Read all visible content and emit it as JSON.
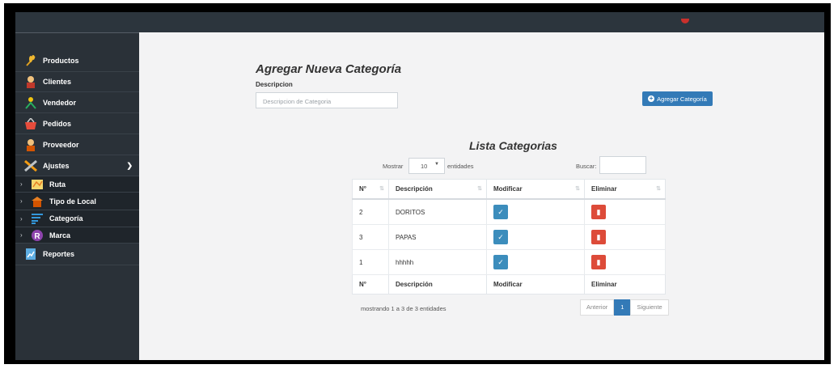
{
  "sidebar": {
    "items": [
      {
        "label": "Productos",
        "icon": "wheat-icon"
      },
      {
        "label": "Clientes",
        "icon": "person-icon"
      },
      {
        "label": "Vendedor",
        "icon": "seller-icon"
      },
      {
        "label": "Pedidos",
        "icon": "basket-icon"
      },
      {
        "label": "Proveedor",
        "icon": "supplier-icon"
      },
      {
        "label": "Ajustes",
        "icon": "tools-icon"
      }
    ],
    "subitems": [
      {
        "label": "Ruta",
        "icon": "map-icon"
      },
      {
        "label": "Tipo de Local",
        "icon": "store-icon"
      },
      {
        "label": "Categoría",
        "icon": "list-icon"
      },
      {
        "label": "Marca",
        "icon": "registered-icon"
      }
    ],
    "reportes": {
      "label": "Reportes",
      "icon": "report-icon"
    }
  },
  "form": {
    "title": "Agregar Nueva Categoría",
    "description_label": "Descripcion",
    "description_placeholder": "Descripcion de Categoria",
    "add_button": "Agregar Categoría"
  },
  "list": {
    "title": "Lista Categorias",
    "show_label": "Mostrar",
    "entries_value": "10",
    "entries_label": "entidades",
    "search_label": "Buscar:",
    "columns": [
      "N°",
      "Descripción",
      "Modificar",
      "Eliminar"
    ],
    "rows": [
      {
        "n": "2",
        "descripcion": "DORITOS"
      },
      {
        "n": "3",
        "descripcion": "PAPAS"
      },
      {
        "n": "1",
        "descripcion": "hhhhh"
      }
    ],
    "showing_text": "mostrando 1 a 3 de 3 entidades",
    "pagination": {
      "prev": "Anterior",
      "current": "1",
      "next": "Siguiente"
    }
  },
  "colors": {
    "sidebar": "#2a3138",
    "primary": "#337ab7",
    "edit_button": "#3c8dbc",
    "delete_button": "#dd4b39"
  }
}
